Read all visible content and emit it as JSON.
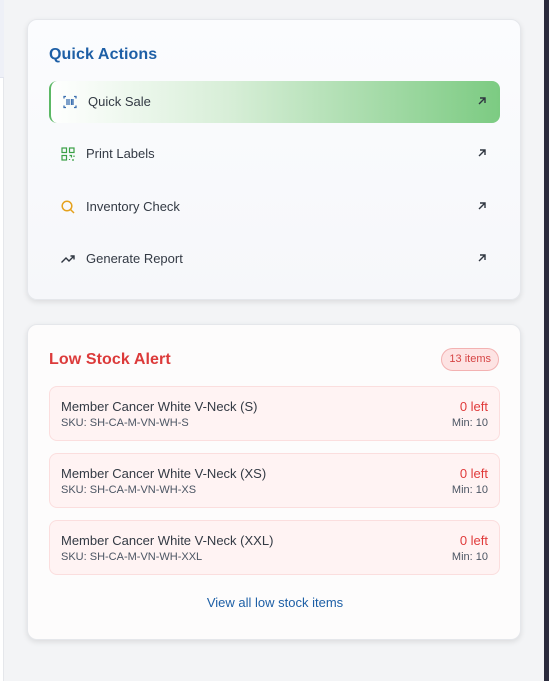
{
  "quick_actions": {
    "title": "Quick Actions",
    "items": [
      {
        "label": "Quick Sale",
        "icon": "barcode-scan-icon",
        "active": true
      },
      {
        "label": "Print Labels",
        "icon": "qr-code-icon",
        "active": false
      },
      {
        "label": "Inventory Check",
        "icon": "search-icon",
        "active": false
      },
      {
        "label": "Generate Report",
        "icon": "trending-up-icon",
        "active": false
      }
    ]
  },
  "low_stock": {
    "title": "Low Stock Alert",
    "badge": "13 items",
    "items": [
      {
        "name": "Member Cancer White V-Neck (S)",
        "sku": "SKU: SH-CA-M-VN-WH-S",
        "left": "0 left",
        "min": "Min: 10"
      },
      {
        "name": "Member Cancer White V-Neck (XS)",
        "sku": "SKU: SH-CA-M-VN-WH-XS",
        "left": "0 left",
        "min": "Min: 10"
      },
      {
        "name": "Member Cancer White V-Neck (XXL)",
        "sku": "SKU: SH-CA-M-VN-WH-XXL",
        "left": "0 left",
        "min": "Min: 10"
      }
    ],
    "view_all": "View all low stock items"
  },
  "colors": {
    "primary_blue": "#1d5fa6",
    "alert_red": "#dc3a3a",
    "active_green": "#7ccb82"
  }
}
